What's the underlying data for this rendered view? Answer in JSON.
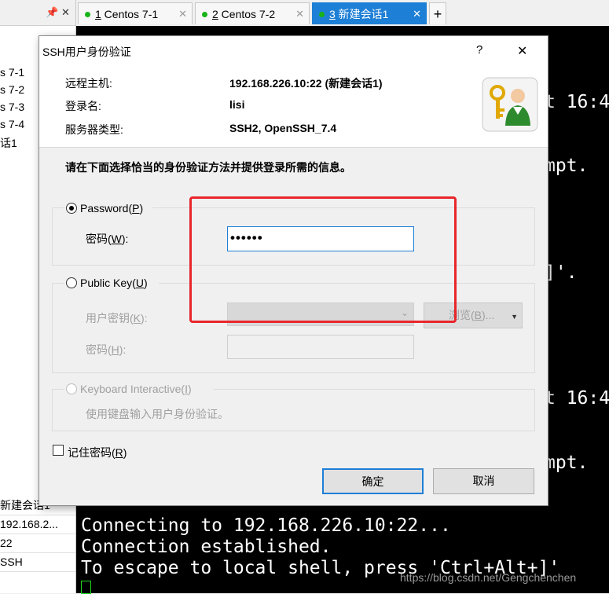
{
  "left_panel": {
    "tree_items": [
      "s 7-1",
      "s 7-2",
      "s 7-3",
      "s 7-4",
      "话1"
    ],
    "properties": [
      "新建会话1",
      "192.168.2...",
      "22",
      "SSH"
    ]
  },
  "tabs": [
    {
      "num": "1",
      "label": " Centos 7-1"
    },
    {
      "num": "2",
      "label": " Centos 7-2"
    },
    {
      "num": "3",
      "label": " 新建会话1"
    }
  ],
  "tab_close_glyph": "✕",
  "tab_add_glyph": "+",
  "terminal": {
    "partial": [
      "t 16:4",
      "mpt.",
      "]'.",
      "t 16:4",
      "mpt."
    ],
    "lines": [
      "Connecting to 192.168.226.10:22...",
      "Connection established.",
      "To escape to local shell, press 'Ctrl+Alt+]'"
    ],
    "watermark": "https://blog.csdn.net/Gengchenchen"
  },
  "dialog": {
    "title": "SSH用户身份验证",
    "help": "?",
    "close": "✕",
    "remote_host_label": "远程主机:",
    "remote_host_value": "192.168.226.10:22 (新建会话1)",
    "login_label": "登录名:",
    "login_value": "lisi",
    "server_type_label": "服务器类型:",
    "server_type_value": "SSH2, OpenSSH_7.4",
    "instruction": "请在下面选择恰当的身份验证方法并提供登录所需的信息。",
    "password_option": {
      "text": "Password(",
      "key": "P",
      "end": ")"
    },
    "password_label": {
      "text": "密码(",
      "key": "W",
      "end": "):"
    },
    "password_value": "••••••",
    "publickey_option": {
      "text": "Public Key(",
      "key": "U",
      "end": ")"
    },
    "user_key_label": {
      "text": "用户密钥(",
      "key": "K",
      "end": "):"
    },
    "browse_button": {
      "text": "浏览(",
      "key": "B",
      "end": ")..."
    },
    "passphrase_label": {
      "text": "密码(",
      "key": "H",
      "end": "):"
    },
    "keyboard_option": {
      "text": "Keyboard Interactive(",
      "key": "I",
      "end": ")"
    },
    "keyboard_desc": "使用键盘输入用户身份验证。",
    "remember_password": {
      "text": "记住密码(",
      "key": "R",
      "end": ")"
    },
    "ok_button": "确定",
    "cancel_button": "取消"
  },
  "colors": {
    "accent": "#1e7fd6",
    "highlight_box": "#e8262b",
    "status_green": "#17b317"
  }
}
